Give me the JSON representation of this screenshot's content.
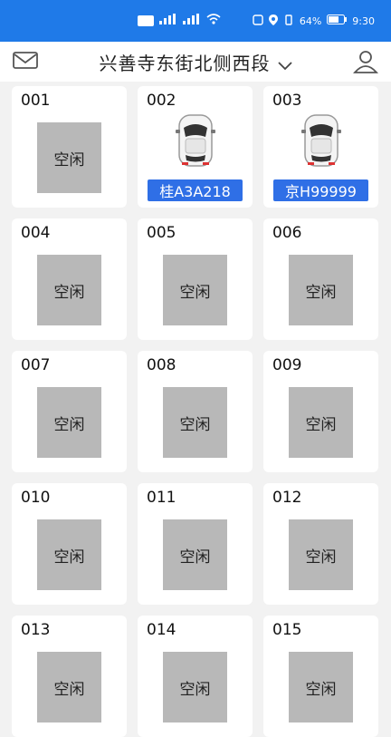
{
  "status_bar": {
    "battery": "64%",
    "time": "9:30"
  },
  "header": {
    "title": "兴善寺东街北侧西段"
  },
  "colors": {
    "accent": "#1f7ae8",
    "plate": "#2f6fe6",
    "free_box": "#b8b8b8"
  },
  "slots": [
    {
      "num": "001",
      "status": "空闲"
    },
    {
      "num": "002",
      "plate": "桂A3A218"
    },
    {
      "num": "003",
      "plate": "京H99999"
    },
    {
      "num": "004",
      "status": "空闲"
    },
    {
      "num": "005",
      "status": "空闲"
    },
    {
      "num": "006",
      "status": "空闲"
    },
    {
      "num": "007",
      "status": "空闲"
    },
    {
      "num": "008",
      "status": "空闲"
    },
    {
      "num": "009",
      "status": "空闲"
    },
    {
      "num": "010",
      "status": "空闲"
    },
    {
      "num": "011",
      "status": "空闲"
    },
    {
      "num": "012",
      "status": "空闲"
    },
    {
      "num": "013",
      "status": "空闲"
    },
    {
      "num": "014",
      "status": "空闲"
    },
    {
      "num": "015",
      "status": "空闲"
    }
  ]
}
